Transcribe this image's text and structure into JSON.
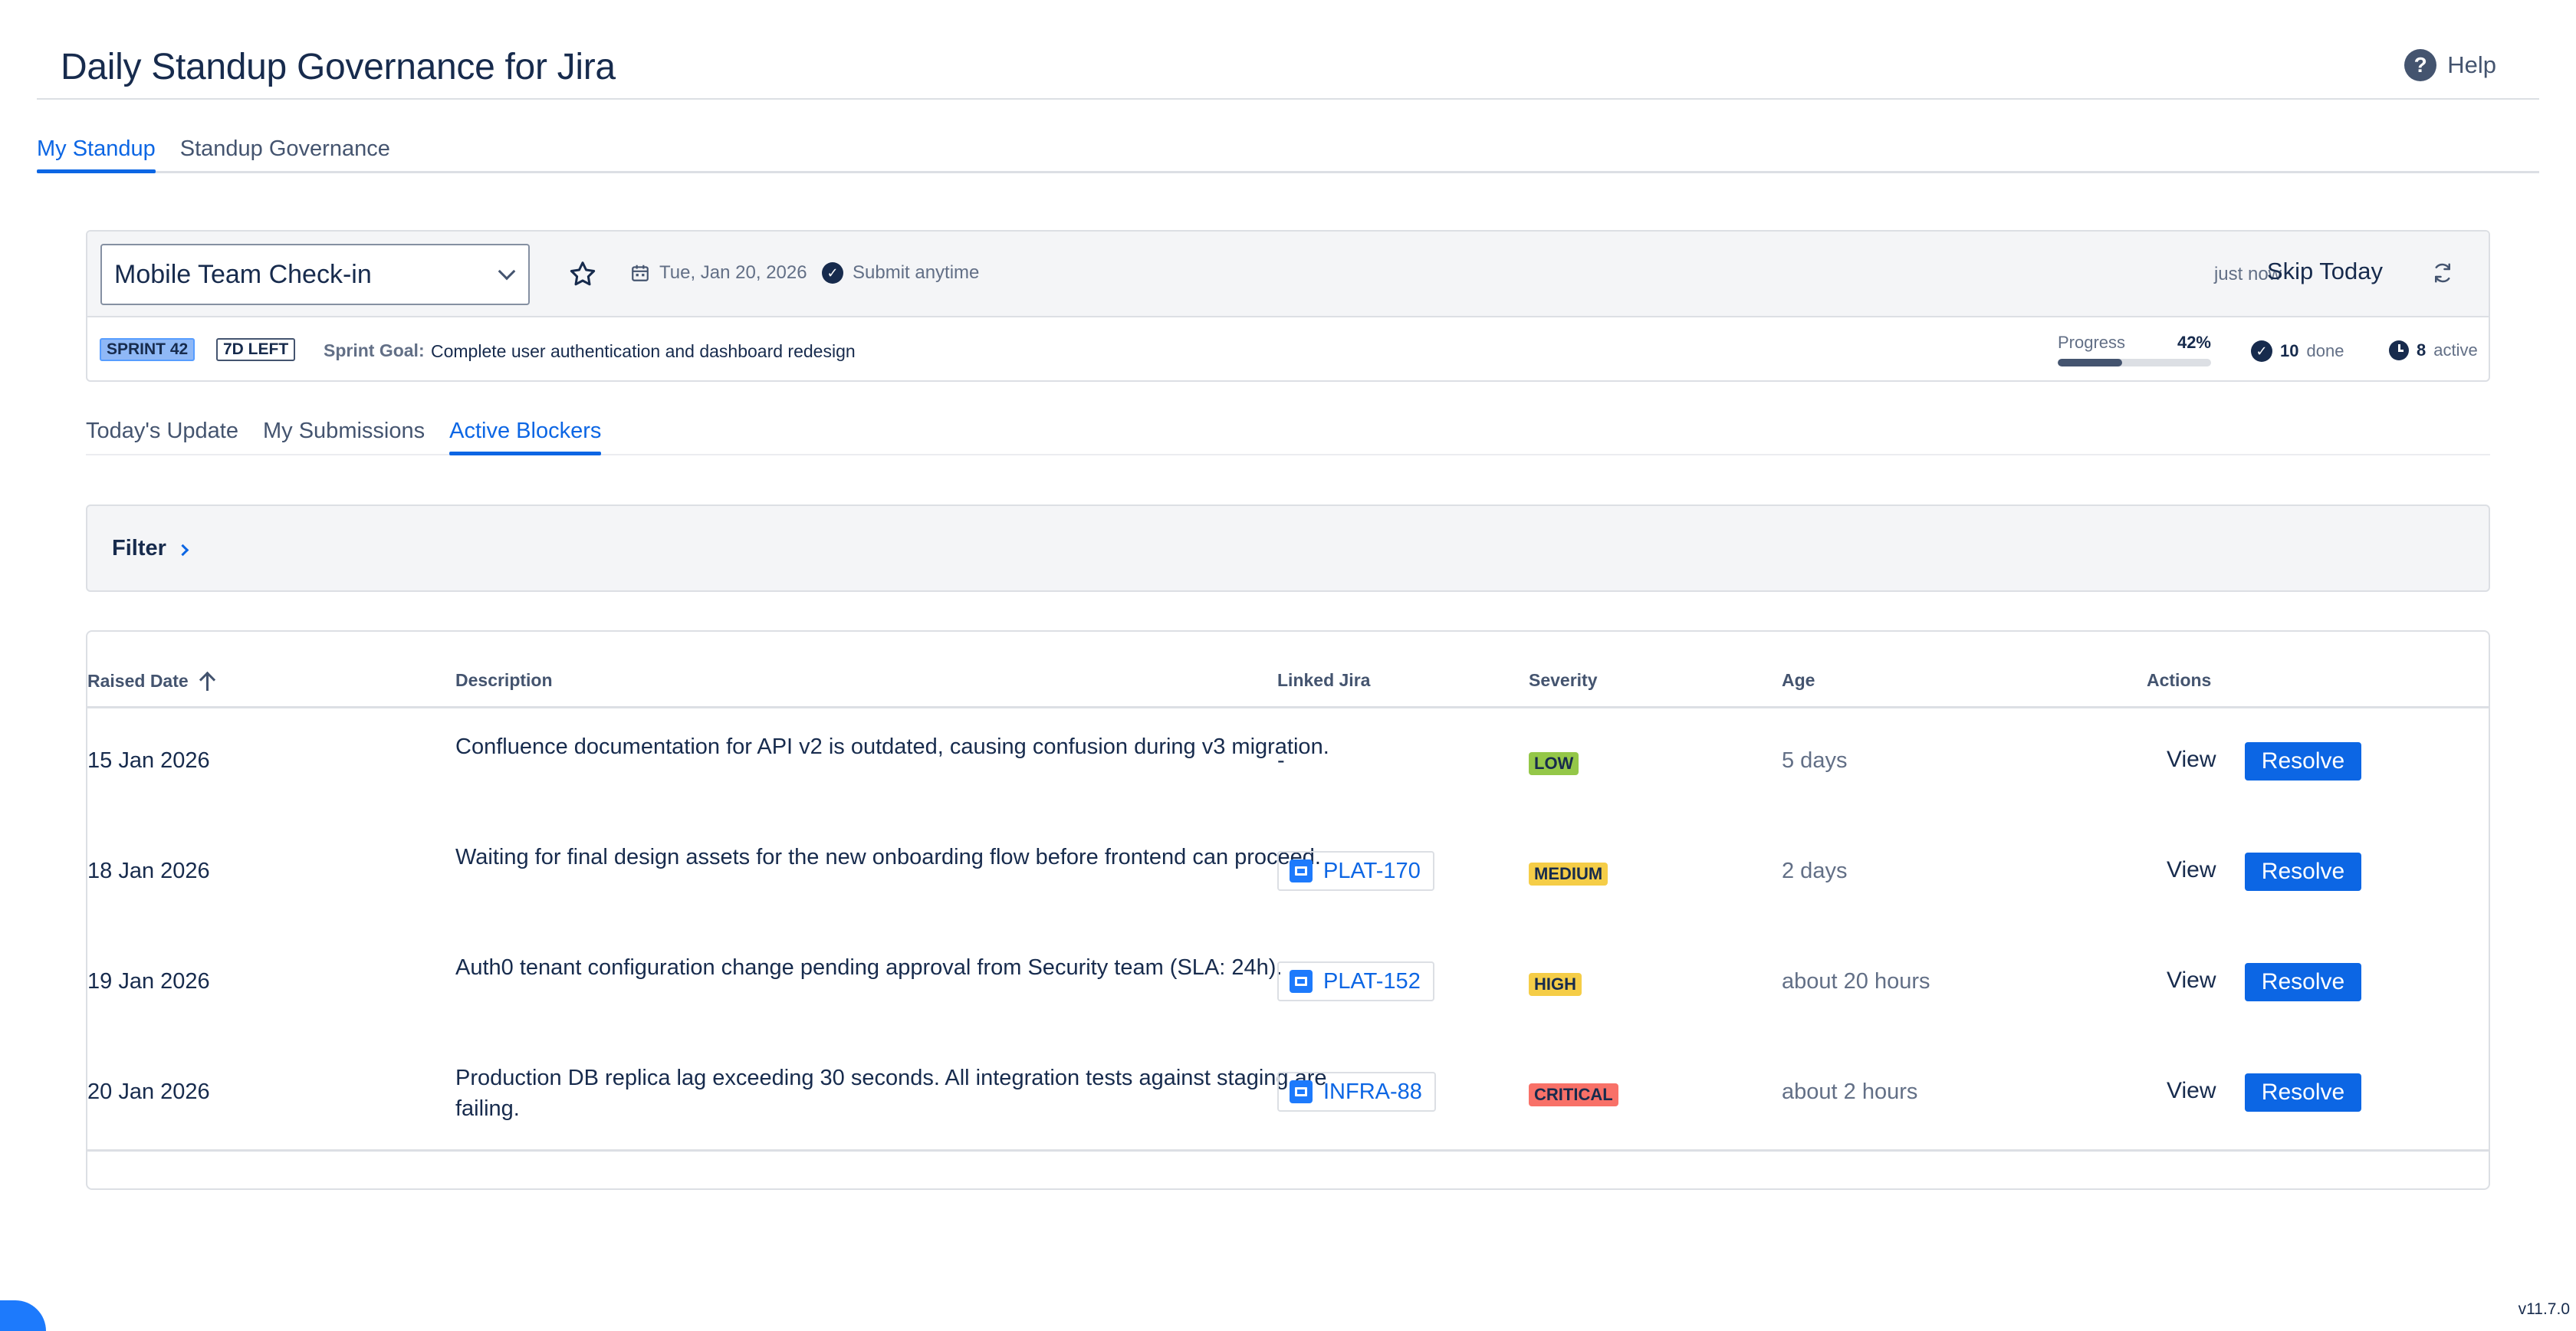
{
  "app": {
    "title": "Daily Standup Governance for Jira",
    "help_label": "Help",
    "version": "v11.7.0"
  },
  "top_tabs": [
    {
      "label": "My Standup",
      "active": true
    },
    {
      "label": "Standup Governance",
      "active": false
    }
  ],
  "context": {
    "standup_selected": "Mobile Team Check-in",
    "date": "Tue, Jan 20, 2026",
    "submit_label": "Submit anytime",
    "last_saved": "just now",
    "skip_label": "Skip Today",
    "sprint_badge": "SPRINT 42",
    "days_left_badge": "7D LEFT",
    "sprint_goal_label": "Sprint Goal:",
    "sprint_goal": "Complete user authentication and dashboard redesign",
    "progress_label": "Progress",
    "progress_pct_text": "42%",
    "progress_value": 0.42,
    "done_count": "10",
    "done_label": "done",
    "active_count": "8",
    "active_label": "active"
  },
  "sub_tabs": [
    {
      "label": "Today's Update",
      "active": false
    },
    {
      "label": "My Submissions",
      "active": false
    },
    {
      "label": "Active Blockers",
      "active": true
    }
  ],
  "filter": {
    "label": "Filter"
  },
  "table": {
    "headers": {
      "raised_date": "Raised Date",
      "description": "Description",
      "linked_jira": "Linked Jira",
      "severity": "Severity",
      "age": "Age",
      "actions": "Actions"
    },
    "view_label": "View",
    "resolve_label": "Resolve",
    "rows": [
      {
        "date": "15 Jan 2026",
        "description": "Confluence documentation for API v2 is outdated, causing confusion during v3 migration.",
        "jira": "-",
        "severity": "LOW",
        "severity_color": "#94c748",
        "age": "5 days"
      },
      {
        "date": "18 Jan 2026",
        "description": "Waiting for final design assets for the new onboarding flow before frontend can proceed.",
        "jira": "PLAT-170",
        "severity": "MEDIUM",
        "severity_color": "#f5cd47",
        "age": "2 days"
      },
      {
        "date": "19 Jan 2026",
        "description": "Auth0 tenant configuration change pending approval from Security team (SLA: 24h).",
        "jira": "PLAT-152",
        "severity": "HIGH",
        "severity_color": "#f5cd47",
        "age": "about 20 hours"
      },
      {
        "date": "20 Jan 2026",
        "description": "Production DB replica lag exceeding 30 seconds. All integration tests against staging are failing.",
        "jira": "INFRA-88",
        "severity": "CRITICAL",
        "severity_color": "#f87168",
        "age": "about 2 hours"
      }
    ]
  },
  "colors": {
    "accent": "#0c66e4",
    "text": "#172b4d",
    "subtle": "#626f86"
  }
}
